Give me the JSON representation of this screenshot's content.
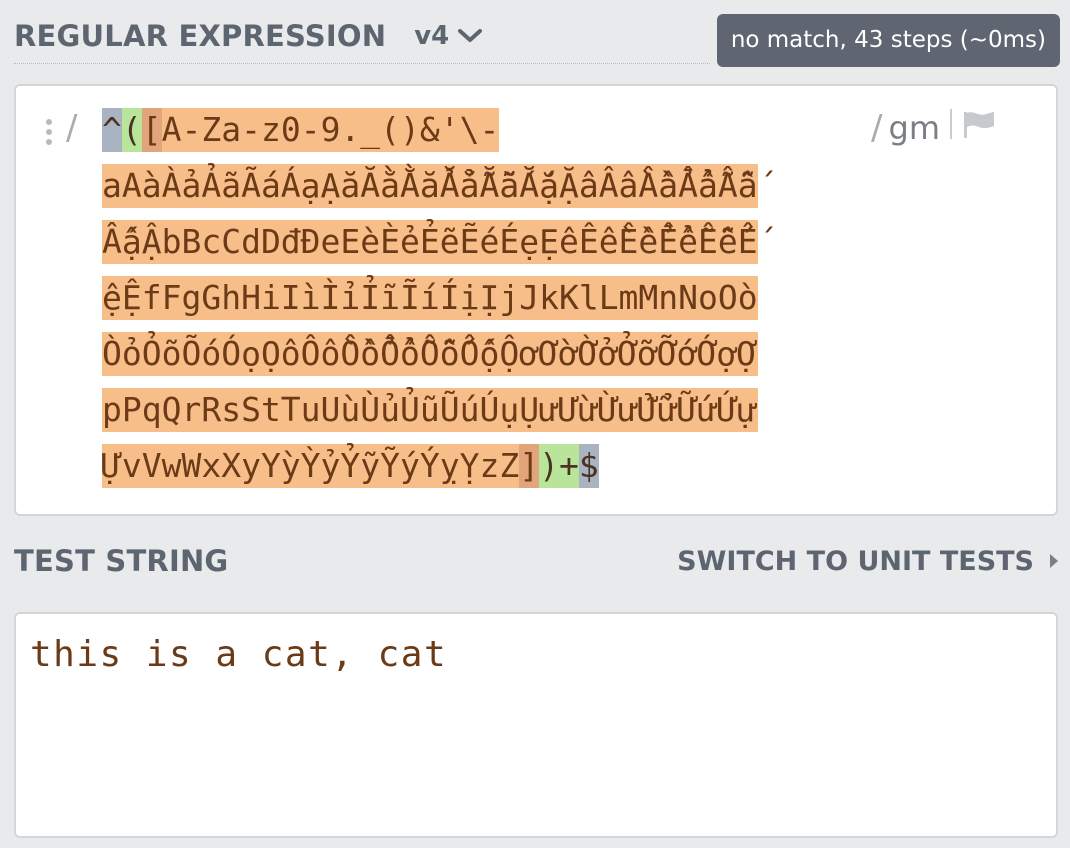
{
  "regex_section": {
    "title": "REGULAR EXPRESSION",
    "flavor": "v4",
    "match_status": "no match, 43 steps (~0ms)",
    "delimiter_open": "/",
    "delimiter_close": "/",
    "flags": "gm",
    "tokens": {
      "caret": "^",
      "group_open": "(",
      "set_open": "[",
      "line1_set_text": "A-Za-z0-9._()&'\\- ",
      "line2": "aAàÀảẢãÃáÁạẠăĂằẰẳẲẵẴắẮặẶâÂầẦẩẨẫẪấ",
      "line3": "ẤậẬbBcCdDđĐeEèÈẻẺẽẼéÉẹẸêÊềỀểỂễỄếẾ",
      "line4": "ệỆfFgGhHiIìÌỉỈĩĨíÍịỊjJkKlLmMnNoOò",
      "line5": "ÒỏỎõÕóÓọỌôÔồỒổỔỗỖốỐộỘơƠờỜởỞỡỠớỚợỢ",
      "line6": "pPqQrRsStTuUùÙủỦũŨúÚụỤưƯừỪửỬữỮứỨự",
      "line7": "ỰvVwWxXyYỳỲỷỶỹỸýÝỵỴzZ",
      "set_close": "]",
      "group_close": ")",
      "plus": "+",
      "dollar": "$"
    },
    "colors": {
      "anchor": "#a9b3c1",
      "group": "#b9e59a",
      "char_set": "#f7be8a",
      "range_dash": "#e2a47a",
      "text": "#6b3a16"
    }
  },
  "test_section": {
    "title": "TEST STRING",
    "switch_label": "SWITCH TO UNIT TESTS",
    "text": "this is a cat, cat"
  },
  "icons": {
    "flavor_dropdown": "chevron-down-icon",
    "flags_flag": "flag-icon",
    "switch_arrow": "caret-right-icon",
    "drag_handle": "drag-handle-icon"
  }
}
